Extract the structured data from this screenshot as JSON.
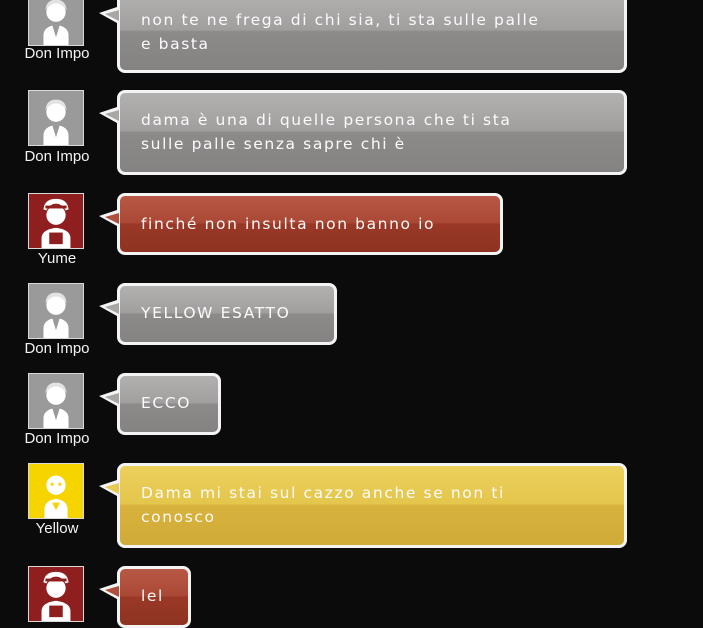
{
  "colors": {
    "background": "#0b0b0b",
    "bubble_gray": "#a19e9e",
    "bubble_red": "#aa4835",
    "bubble_yellow": "#e4c64c",
    "avatar_gray": "#9a9a9a",
    "avatar_red": "#8f1f1f",
    "avatar_yellow": "#f5d400"
  },
  "messages": [
    {
      "user": "Don Impo",
      "avatar": "person-gray-icon",
      "text": [
        "non te ne frega di chi sia, ti sta sulle palle",
        "e basta"
      ]
    },
    {
      "user": "Don Impo",
      "avatar": "person-gray-icon",
      "text": [
        "dama è una di quelle persona che ti sta",
        "sulle palle senza sapre chi è"
      ]
    },
    {
      "user": "Yume",
      "avatar": "person-red-icon",
      "text": [
        "finché non insulta non banno io"
      ]
    },
    {
      "user": "Don Impo",
      "avatar": "person-gray-icon",
      "text": [
        "YELLOW ESATTO"
      ]
    },
    {
      "user": "Don Impo",
      "avatar": "person-gray-icon",
      "text": [
        "ECCO"
      ]
    },
    {
      "user": "Yellow",
      "avatar": "person-yellow-icon",
      "text": [
        "Dama mi stai sul cazzo anche se non ti",
        "conosco"
      ]
    },
    {
      "user": "Yume",
      "avatar": "person-red-icon",
      "text": [
        "lel"
      ]
    }
  ]
}
